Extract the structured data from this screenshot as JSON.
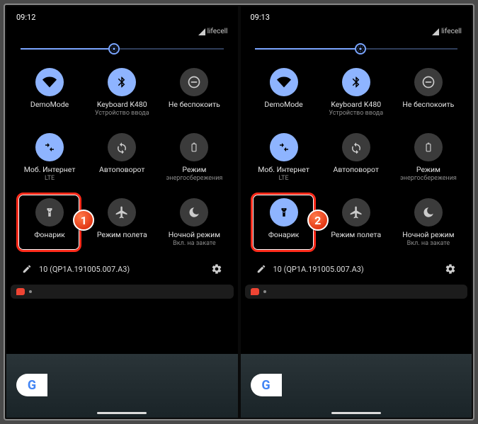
{
  "left": {
    "time": "09:12",
    "carrier": "lifecell",
    "brightness_percent": 46,
    "badge": "1",
    "build": "10 (QP1A.191005.007.A3)",
    "flashlight_active": false
  },
  "right": {
    "time": "09:13",
    "carrier": "lifecell",
    "brightness_percent": 52,
    "badge": "2",
    "build": "10 (QP1A.191005.007.A3)",
    "flashlight_active": true
  },
  "tiles": [
    {
      "key": "wifi",
      "label": "DemoMode",
      "sub": "",
      "active": true,
      "icon": "wifi"
    },
    {
      "key": "bluetooth",
      "label": "Keyboard K480",
      "sub": "Устройство ввода",
      "active": true,
      "icon": "bluetooth"
    },
    {
      "key": "dnd",
      "label": "Не беспокоить",
      "sub": "",
      "active": false,
      "icon": "dnd"
    },
    {
      "key": "mobile",
      "label": "Моб. Интернет",
      "sub": "LTE",
      "active": true,
      "icon": "mobile"
    },
    {
      "key": "rotate",
      "label": "Автоповорот",
      "sub": "",
      "active": false,
      "icon": "rotate"
    },
    {
      "key": "battery",
      "label": "Режим",
      "sub": "энергосбережения",
      "active": false,
      "icon": "battery"
    },
    {
      "key": "flashlight",
      "label": "Фонарик",
      "sub": "",
      "active": false,
      "icon": "flashlight"
    },
    {
      "key": "airplane",
      "label": "Режим полета",
      "sub": "",
      "active": false,
      "icon": "airplane"
    },
    {
      "key": "night",
      "label": "Ночной режим",
      "sub": "Вкл. на закате",
      "active": false,
      "icon": "night"
    }
  ],
  "google": "G"
}
